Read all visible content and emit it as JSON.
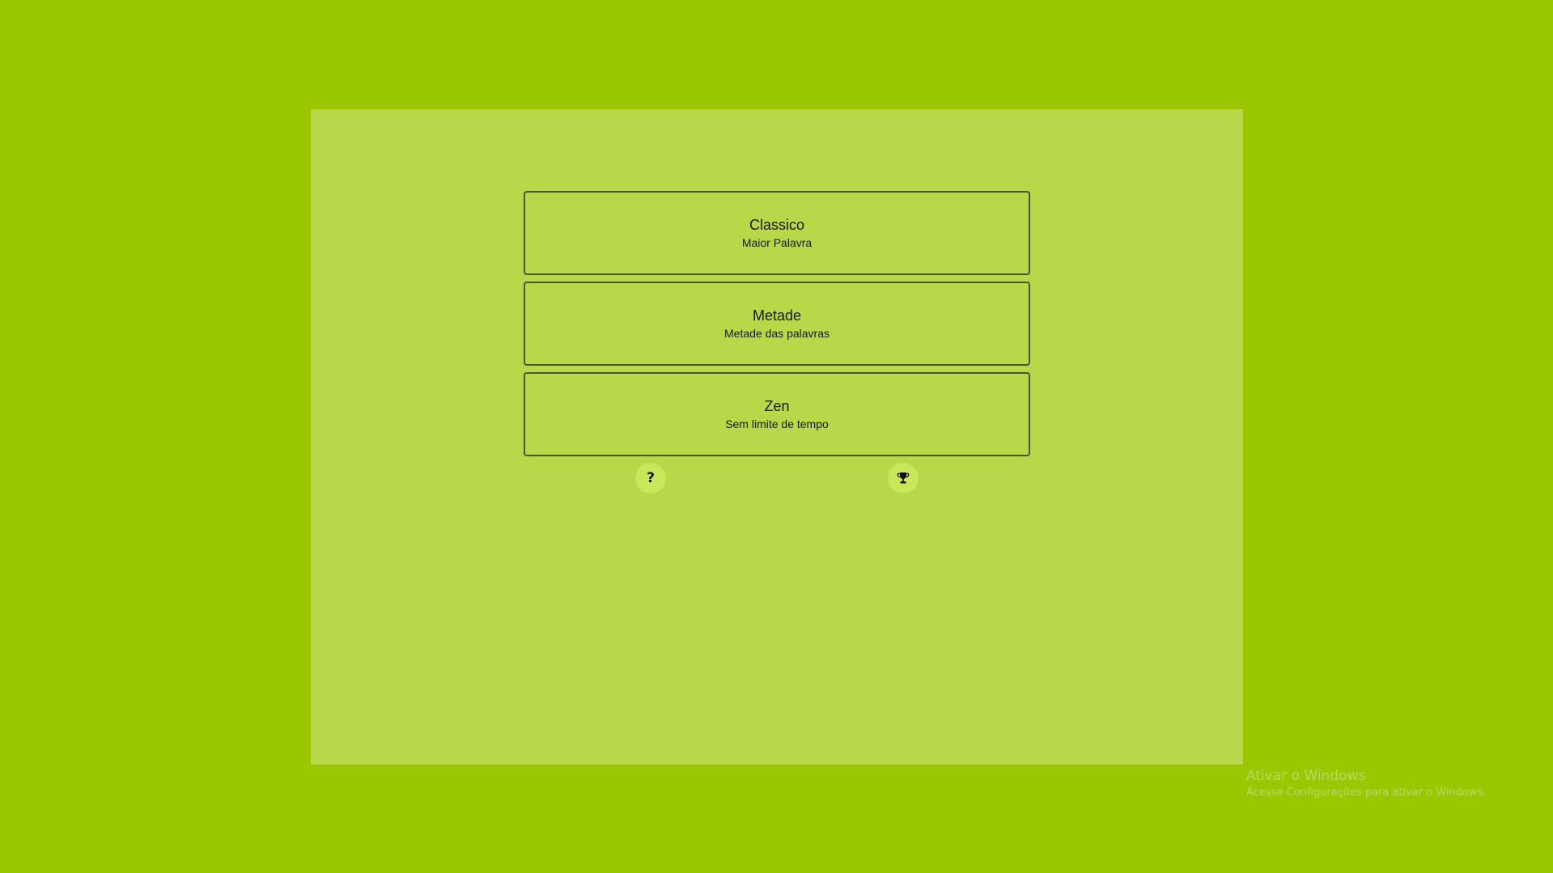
{
  "modes": [
    {
      "title": "Classico",
      "subtitle": "Maior Palavra"
    },
    {
      "title": "Metade",
      "subtitle": "Metade das palavras"
    },
    {
      "title": "Zen",
      "subtitle": "Sem limite de tempo"
    }
  ],
  "buttons": {
    "help_label": "?",
    "help_icon": "question-icon",
    "trophy_icon": "trophy-icon"
  },
  "watermark": {
    "title": "Ativar o Windows",
    "subtitle": "Acesse Configurações para ativar o Windows."
  },
  "colors": {
    "background": "#9bc700",
    "panel": "#b7d849",
    "round_button": "#c8e75b",
    "border": "#4a5530"
  }
}
